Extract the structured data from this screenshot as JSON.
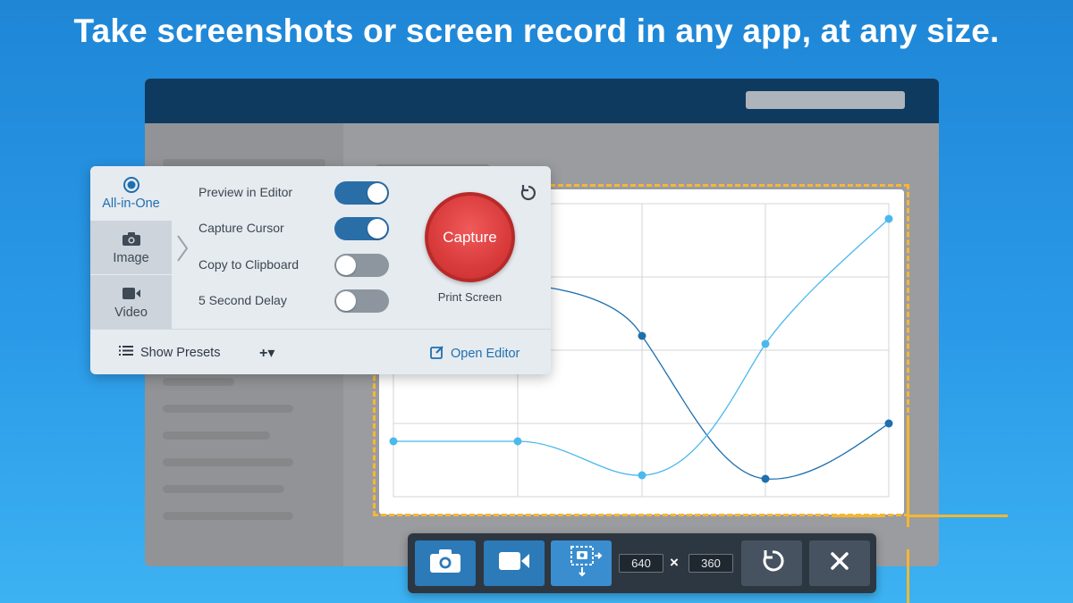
{
  "headline": "Take screenshots or screen record in any app, at any size.",
  "panel": {
    "tabs": [
      {
        "label": "All-in-One",
        "icon": "radio-dot-icon",
        "active": true
      },
      {
        "label": "Image",
        "icon": "camera-icon",
        "active": false
      },
      {
        "label": "Video",
        "icon": "video-camera-icon",
        "active": false
      }
    ],
    "options": [
      {
        "label": "Preview in Editor",
        "on": true
      },
      {
        "label": "Capture Cursor",
        "on": true
      },
      {
        "label": "Copy to Clipboard",
        "on": false
      },
      {
        "label": "5 Second Delay",
        "on": false
      }
    ],
    "capture_label": "Capture",
    "capture_hotkey": "Print Screen",
    "show_presets": "Show Presets",
    "add_preset": "+▾",
    "open_editor": "Open Editor"
  },
  "toolbar": {
    "width": "640",
    "height": "360",
    "times": "×"
  },
  "colors": {
    "accent": "#2a6ea8",
    "capture_red": "#d93b3b",
    "selection_yellow": "#f7b733",
    "toolbar_bg": "#2d3741"
  }
}
